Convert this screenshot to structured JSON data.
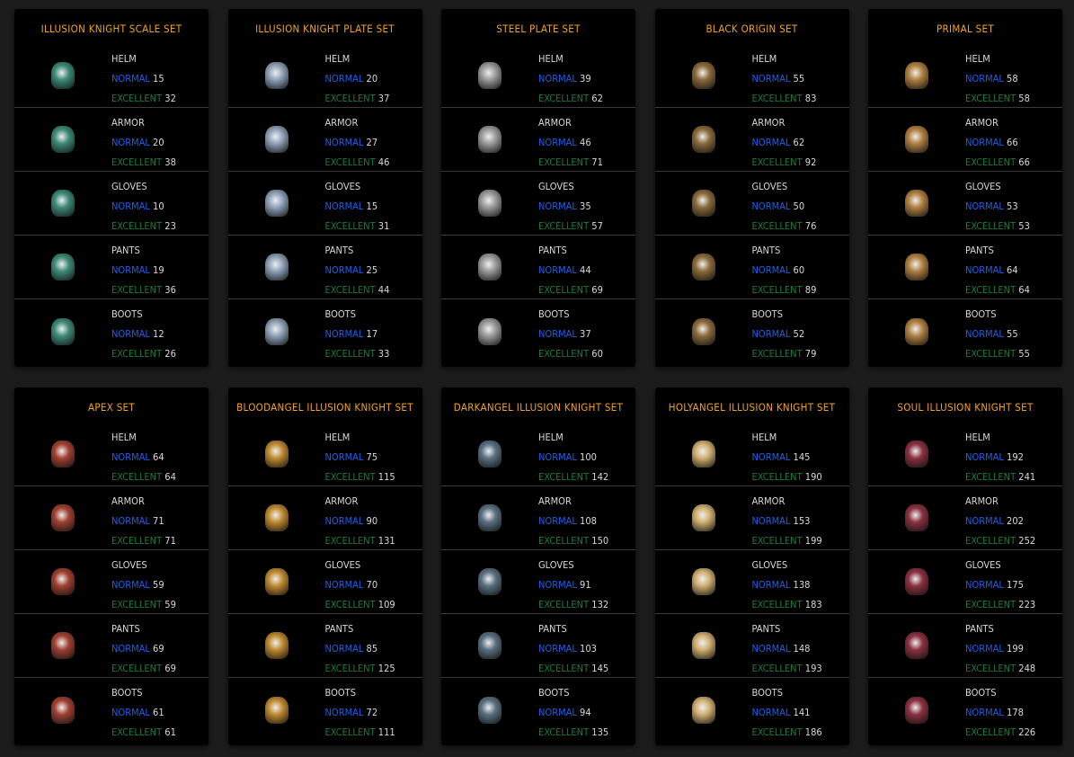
{
  "labels": {
    "normal": "NORMAL",
    "excellent": "EXCELLENT"
  },
  "colors": {
    "title": "#f0a21e",
    "normal": "#1f5ee8",
    "excellent": "#1d7a3a",
    "card": "#000000",
    "background": "#1c1c1c"
  },
  "sets": [
    {
      "title": "ILLUSION KNIGHT SCALE SET",
      "icon_color": "#3d8a78",
      "items": [
        {
          "piece": "HELM",
          "normal": "15",
          "excellent": "32"
        },
        {
          "piece": "ARMOR",
          "normal": "20",
          "excellent": "38"
        },
        {
          "piece": "GLOVES",
          "normal": "10",
          "excellent": "23"
        },
        {
          "piece": "PANTS",
          "normal": "19",
          "excellent": "36"
        },
        {
          "piece": "BOOTS",
          "normal": "12",
          "excellent": "26"
        }
      ]
    },
    {
      "title": "ILLUSION KNIGHT PLATE SET",
      "icon_color": "#8fa2b8",
      "items": [
        {
          "piece": "HELM",
          "normal": "20",
          "excellent": "37"
        },
        {
          "piece": "ARMOR",
          "normal": "27",
          "excellent": "46"
        },
        {
          "piece": "GLOVES",
          "normal": "15",
          "excellent": "31"
        },
        {
          "piece": "PANTS",
          "normal": "25",
          "excellent": "44"
        },
        {
          "piece": "BOOTS",
          "normal": "17",
          "excellent": "33"
        }
      ]
    },
    {
      "title": "STEEL PLATE SET",
      "icon_color": "#9a9a9a",
      "items": [
        {
          "piece": "HELM",
          "normal": "39",
          "excellent": "62"
        },
        {
          "piece": "ARMOR",
          "normal": "46",
          "excellent": "71"
        },
        {
          "piece": "GLOVES",
          "normal": "35",
          "excellent": "57"
        },
        {
          "piece": "PANTS",
          "normal": "44",
          "excellent": "69"
        },
        {
          "piece": "BOOTS",
          "normal": "37",
          "excellent": "60"
        }
      ]
    },
    {
      "title": "BLACK ORIGIN SET",
      "icon_color": "#8a6a3a",
      "items": [
        {
          "piece": "HELM",
          "normal": "55",
          "excellent": "83"
        },
        {
          "piece": "ARMOR",
          "normal": "62",
          "excellent": "92"
        },
        {
          "piece": "GLOVES",
          "normal": "50",
          "excellent": "76"
        },
        {
          "piece": "PANTS",
          "normal": "60",
          "excellent": "89"
        },
        {
          "piece": "BOOTS",
          "normal": "52",
          "excellent": "79"
        }
      ]
    },
    {
      "title": "PRIMAL SET",
      "icon_color": "#b08040",
      "items": [
        {
          "piece": "HELM",
          "normal": "58",
          "excellent": "58"
        },
        {
          "piece": "ARMOR",
          "normal": "66",
          "excellent": "66"
        },
        {
          "piece": "GLOVES",
          "normal": "53",
          "excellent": "53"
        },
        {
          "piece": "PANTS",
          "normal": "64",
          "excellent": "64"
        },
        {
          "piece": "BOOTS",
          "normal": "55",
          "excellent": "55"
        }
      ]
    },
    {
      "title": "APEX SET",
      "icon_color": "#a04030",
      "items": [
        {
          "piece": "HELM",
          "normal": "64",
          "excellent": "64"
        },
        {
          "piece": "ARMOR",
          "normal": "71",
          "excellent": "71"
        },
        {
          "piece": "GLOVES",
          "normal": "59",
          "excellent": "59"
        },
        {
          "piece": "PANTS",
          "normal": "69",
          "excellent": "69"
        },
        {
          "piece": "BOOTS",
          "normal": "61",
          "excellent": "61"
        }
      ]
    },
    {
      "title": "BLOODANGEL ILLUSION KNIGHT SET",
      "icon_color": "#c08a30",
      "items": [
        {
          "piece": "HELM",
          "normal": "75",
          "excellent": "115"
        },
        {
          "piece": "ARMOR",
          "normal": "90",
          "excellent": "131"
        },
        {
          "piece": "GLOVES",
          "normal": "70",
          "excellent": "109"
        },
        {
          "piece": "PANTS",
          "normal": "85",
          "excellent": "125"
        },
        {
          "piece": "BOOTS",
          "normal": "72",
          "excellent": "111"
        }
      ]
    },
    {
      "title": "DARKANGEL ILLUSION KNIGHT SET",
      "icon_color": "#5a7080",
      "items": [
        {
          "piece": "HELM",
          "normal": "100",
          "excellent": "142"
        },
        {
          "piece": "ARMOR",
          "normal": "108",
          "excellent": "150"
        },
        {
          "piece": "GLOVES",
          "normal": "91",
          "excellent": "132"
        },
        {
          "piece": "PANTS",
          "normal": "103",
          "excellent": "145"
        },
        {
          "piece": "BOOTS",
          "normal": "94",
          "excellent": "135"
        }
      ]
    },
    {
      "title": "HOLYANGEL ILLUSION KNIGHT SET",
      "icon_color": "#d0b070",
      "items": [
        {
          "piece": "HELM",
          "normal": "145",
          "excellent": "190"
        },
        {
          "piece": "ARMOR",
          "normal": "153",
          "excellent": "199"
        },
        {
          "piece": "GLOVES",
          "normal": "138",
          "excellent": "183"
        },
        {
          "piece": "PANTS",
          "normal": "148",
          "excellent": "193"
        },
        {
          "piece": "BOOTS",
          "normal": "141",
          "excellent": "186"
        }
      ]
    },
    {
      "title": "SOUL ILLUSION KNIGHT SET",
      "icon_color": "#8a3040",
      "items": [
        {
          "piece": "HELM",
          "normal": "192",
          "excellent": "241"
        },
        {
          "piece": "ARMOR",
          "normal": "202",
          "excellent": "252"
        },
        {
          "piece": "GLOVES",
          "normal": "175",
          "excellent": "223"
        },
        {
          "piece": "PANTS",
          "normal": "199",
          "excellent": "248"
        },
        {
          "piece": "BOOTS",
          "normal": "178",
          "excellent": "226"
        }
      ]
    }
  ]
}
